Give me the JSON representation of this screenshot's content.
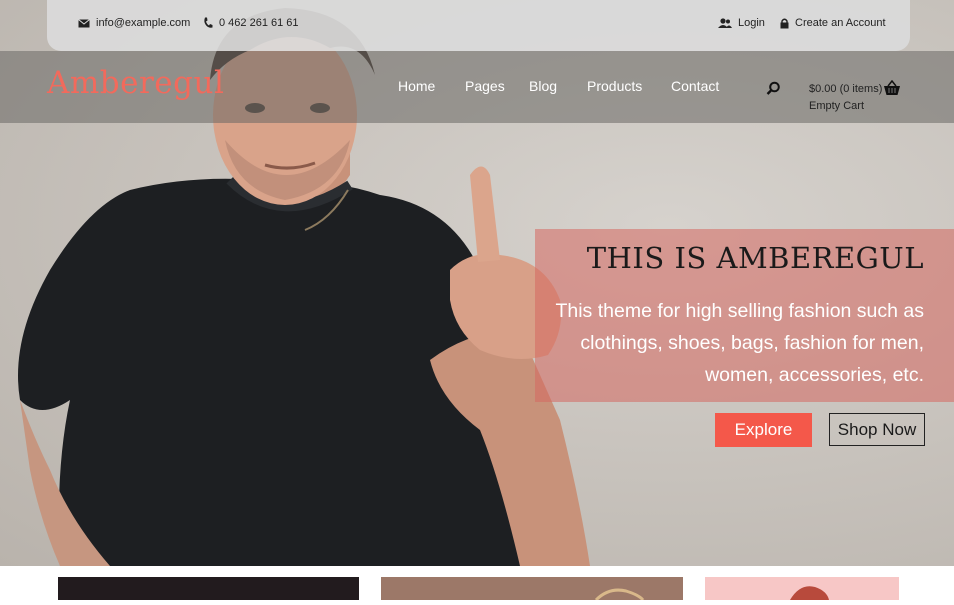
{
  "topbar": {
    "email": "info@example.com",
    "phone": "0 462 261 61 61",
    "login_label": "Login",
    "create_account_label": "Create an Account"
  },
  "header": {
    "logo": "Amberegul",
    "nav": [
      "Home",
      "Pages",
      "Blog",
      "Products",
      "Contact"
    ],
    "cart_total": "$0.00 (0 items)",
    "cart_status": "Empty Cart"
  },
  "hero": {
    "title": "THIS IS AMBEREGUL",
    "text": "This theme for high selling fashion such as clothings, shoes, bags, fashion for men, women, accessories, etc.",
    "explore_label": "Explore",
    "shop_label": "Shop Now"
  },
  "colors": {
    "accent": "#f26a5c",
    "button": "#f4584a",
    "caption_bg": "#d66860"
  },
  "icons": [
    "envelope-icon",
    "phone-icon",
    "user-icon",
    "lock-icon",
    "search-icon",
    "basket-icon"
  ]
}
